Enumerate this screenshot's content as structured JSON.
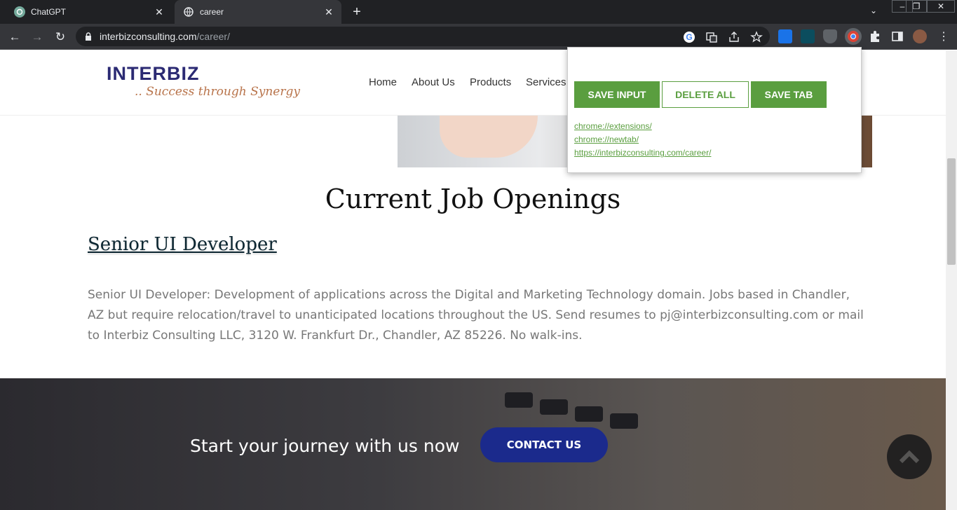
{
  "browser": {
    "tabs": [
      {
        "title": "ChatGPT",
        "icon": "chatgpt-icon"
      },
      {
        "title": "career",
        "icon": "globe-icon"
      }
    ],
    "url_domain": "interbizconsulting.com",
    "url_path": "/career/"
  },
  "site": {
    "logo_main": "INTERBIZ",
    "logo_tagline": ".. Success through Synergy",
    "nav": [
      "Home",
      "About Us",
      "Products",
      "Services"
    ]
  },
  "main": {
    "heading": "Current Job Openings",
    "job_title": "Senior UI Developer",
    "job_description": "Senior UI Developer: Development of applications across the Digital and Marketing Technology domain. Jobs based in Chandler, AZ but require relocation/travel to unanticipated locations throughout the US. Send resumes to pj@interbizconsulting.com or mail to Interbiz Consulting LLC, 3120 W. Frankfurt Dr., Chandler, AZ 85226. No walk-ins."
  },
  "footer": {
    "cta_text": "Start your journey with us now",
    "contact_label": "CONTACT US"
  },
  "popup": {
    "save_input": "SAVE INPUT",
    "delete_all": "DELETE ALL",
    "save_tab": "SAVE TAB",
    "links": [
      "chrome://extensions/",
      "chrome://newtab/",
      "https://interbizconsulting.com/career/"
    ]
  },
  "colors": {
    "accent_green": "#5a9e3f",
    "brand_navy": "#2b2a73",
    "contact_blue": "#1b2a8c"
  }
}
